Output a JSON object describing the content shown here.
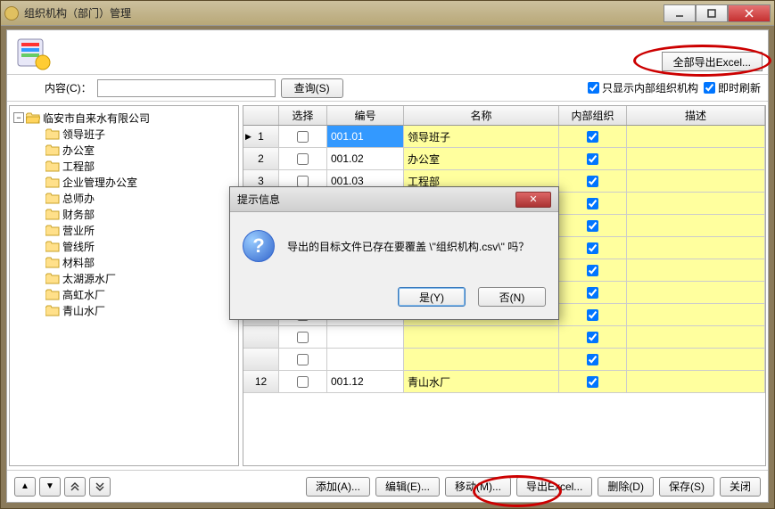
{
  "window": {
    "title": "组织机构（部门）管理"
  },
  "toolbar": {
    "export_all_label": "全部导出Excel...",
    "content_label": "内容(C)：",
    "query_label": "查询(S)",
    "show_internal_label": "只显示内部组织机构",
    "show_internal_checked": true,
    "refresh_label": "即时刷新",
    "refresh_checked": true,
    "content_value": ""
  },
  "tree": {
    "root": {
      "label": "临安市自来水有限公司",
      "expanded": true
    },
    "children": [
      {
        "label": "领导班子"
      },
      {
        "label": "办公室"
      },
      {
        "label": "工程部"
      },
      {
        "label": "企业管理办公室"
      },
      {
        "label": "总师办"
      },
      {
        "label": "财务部"
      },
      {
        "label": "营业所"
      },
      {
        "label": "管线所"
      },
      {
        "label": "材料部"
      },
      {
        "label": "太湖源水厂"
      },
      {
        "label": "高虹水厂"
      },
      {
        "label": "青山水厂"
      }
    ]
  },
  "grid": {
    "headers": {
      "sel": "选择",
      "code": "编号",
      "name": "名称",
      "internal": "内部组织",
      "desc": "描述"
    },
    "rows": [
      {
        "num": "1",
        "ptr": true,
        "sel": false,
        "code": "001.01",
        "name": "领导班子",
        "internal": true,
        "selected": true
      },
      {
        "num": "2",
        "sel": false,
        "code": "001.02",
        "name": "办公室",
        "internal": true
      },
      {
        "num": "3",
        "sel": false,
        "code": "001.03",
        "name": "工程部",
        "internal": true
      },
      {
        "num": "",
        "sel": false,
        "code": "",
        "name": "",
        "internal": true,
        "obscured": true
      },
      {
        "num": "",
        "sel": false,
        "code": "",
        "name": "",
        "internal": true,
        "obscured": true
      },
      {
        "num": "",
        "sel": false,
        "code": "",
        "name": "",
        "internal": true,
        "obscured": true
      },
      {
        "num": "",
        "sel": false,
        "code": "",
        "name": "",
        "internal": true,
        "obscured": true
      },
      {
        "num": "",
        "sel": false,
        "code": "",
        "name": "",
        "internal": true,
        "obscured": true
      },
      {
        "num": "",
        "sel": false,
        "code": "",
        "name": "",
        "internal": true,
        "obscured": true
      },
      {
        "num": "",
        "sel": false,
        "code": "",
        "name": "",
        "internal": true,
        "obscured": true
      },
      {
        "num": "",
        "sel": false,
        "code": "",
        "name": "",
        "internal": true,
        "obscured": true
      },
      {
        "num": "12",
        "sel": false,
        "code": "001.12",
        "name": "青山水厂",
        "internal": true
      }
    ]
  },
  "bottom": {
    "add": "添加(A)...",
    "edit": "编辑(E)...",
    "move": "移动(M)...",
    "export": "导出Excel...",
    "delete": "删除(D)",
    "save": "保存(S)",
    "close": "关闭"
  },
  "dialog": {
    "title": "提示信息",
    "message": "导出的目标文件已存在要覆盖 \\\"组织机构.csv\\\" 吗？",
    "yes": "是(Y)",
    "no": "否(N)"
  },
  "colors": {
    "highlight": "#ffff9e",
    "selection": "#3399ff",
    "annotation": "#cc0000"
  }
}
